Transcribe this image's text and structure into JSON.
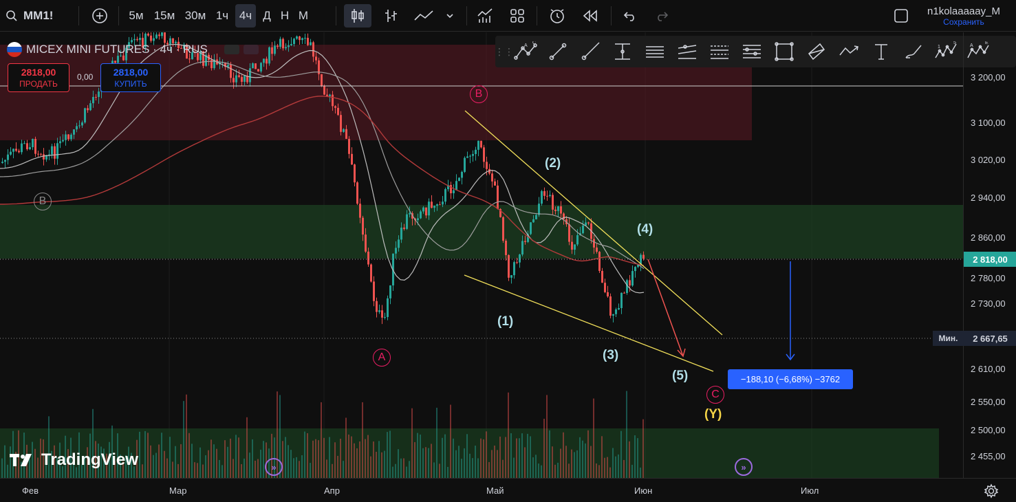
{
  "toolbar": {
    "symbol": "MM1!",
    "intervals": [
      "5м",
      "15м",
      "30м",
      "1ч",
      "4ч",
      "Д",
      "Н",
      "М"
    ],
    "active_interval": "4ч",
    "user_name": "n1kolaaaaay_M",
    "save_label": "Сохранить"
  },
  "legend": {
    "title": "MICEX MINI FUTURES · 4ч · RUS",
    "sell_price": "2818,00",
    "sell_label": "ПРОДАТЬ",
    "spread": "0,00",
    "buy_price": "2818,00",
    "buy_label": "КУПИТЬ"
  },
  "drawing_toolbar": {
    "tools": [
      "elliott-abc-icon",
      "trend-line-icon",
      "ray-icon",
      "vertical-arrow-icon",
      "horizontal-lines-icon",
      "parallel-channel-icon",
      "fib-retracement-icon",
      "fib-extension-icon",
      "rectangle-icon",
      "channel-icon",
      "path-icon",
      "text-icon",
      "brush-icon",
      "elliott-impulse-icon",
      "elliott-correction-icon"
    ],
    "labels": {
      "elliott_abc": [
        "A",
        "C"
      ],
      "elliott_impulse": [
        "1",
        "5"
      ],
      "elliott_correction": [
        "A",
        "E"
      ]
    }
  },
  "price_axis": {
    "ticks": [
      "3 200,00",
      "3 100,00",
      "3 020,00",
      "2 940,00",
      "2 860,00",
      "2 780,00",
      "2 730,00",
      "2 610,00",
      "2 550,00",
      "2 500,00",
      "2 455,00"
    ],
    "current_price": "2 818,00",
    "min_label": "Мин.",
    "min_price": "2 667,65"
  },
  "time_axis": {
    "labels": [
      "Фев",
      "Мар",
      "Апр",
      "Май",
      "Июн",
      "Июл"
    ]
  },
  "waves": {
    "w1": "(1)",
    "w2": "(2)",
    "w3": "(3)",
    "w4": "(4)",
    "w5": "(5)",
    "y": "(Y)",
    "a": "A",
    "b": "B",
    "c": "C",
    "b_left": "B"
  },
  "measure": {
    "text": "−188,10 (−6,68%) −3762"
  },
  "brand": {
    "logo_text": "TradingView"
  },
  "colors": {
    "up": "#26a69a",
    "down": "#ef5350",
    "accent": "#2962ff",
    "wave_label": "#b2dfe8",
    "abc_label": "#e91e63",
    "y_label": "#f5d547",
    "trendline": "#f2e05a"
  }
}
